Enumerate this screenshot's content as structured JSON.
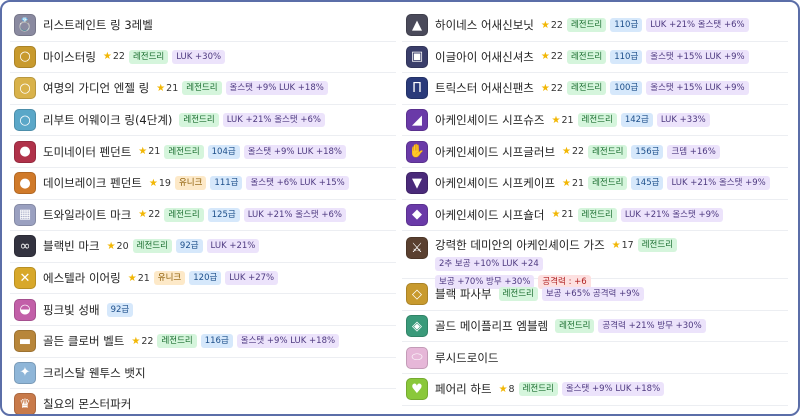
{
  "left": [
    {
      "icon": "ring-icon",
      "color": "#8a8aa0",
      "glyph": "💍",
      "name": "리스트레인트 링 3레벨",
      "star": "",
      "tier": "",
      "tier_class": "",
      "level": "",
      "stats": ""
    },
    {
      "icon": "ring-icon",
      "color": "#c89a2e",
      "glyph": "○",
      "name": "마이스터링",
      "star": "22",
      "tier": "레전드리",
      "tier_class": "t-leg",
      "level": "",
      "stats": "LUK +30%"
    },
    {
      "icon": "ring-icon",
      "color": "#d9b24a",
      "glyph": "○",
      "name": "여명의 가디언 엔젤 링",
      "star": "21",
      "tier": "레전드리",
      "tier_class": "t-leg",
      "level": "",
      "stats": "올스탯 +9% LUK +18%"
    },
    {
      "icon": "ring-icon",
      "color": "#5aa7c8",
      "glyph": "○",
      "name": "리부트 어웨이크 링(4단계)",
      "star": "",
      "tier": "레전드리",
      "tier_class": "t-leg",
      "level": "",
      "stats": "LUK +21% 올스탯 +6%"
    },
    {
      "icon": "pendant-icon",
      "color": "#b0324a",
      "glyph": "●",
      "name": "도미네이터 펜던트",
      "star": "21",
      "tier": "레전드리",
      "tier_class": "t-leg",
      "level": "104급",
      "stats": "올스탯 +9% LUK +18%"
    },
    {
      "icon": "pendant-icon",
      "color": "#d07a2a",
      "glyph": "●",
      "name": "데이브레이크 펜던트",
      "star": "19",
      "tier": "유니크",
      "tier_class": "t-uni",
      "level": "111급",
      "stats": "올스탯 +6% LUK +15%"
    },
    {
      "icon": "mark-icon",
      "color": "#9aa0c0",
      "glyph": "▦",
      "name": "트와일라이트 마크",
      "star": "22",
      "tier": "레전드리",
      "tier_class": "t-leg",
      "level": "125급",
      "stats": "LUK +21% 올스탯 +6%"
    },
    {
      "icon": "glasses-icon",
      "color": "#333340",
      "glyph": "∞",
      "name": "블랙빈 마크",
      "star": "20",
      "tier": "레전드리",
      "tier_class": "t-leg",
      "level": "92급",
      "stats": "LUK +21%"
    },
    {
      "icon": "earring-icon",
      "color": "#d8a82a",
      "glyph": "✕",
      "name": "에스텔라 이어링",
      "star": "21",
      "tier": "유니크",
      "tier_class": "t-uni",
      "level": "120급",
      "stats": "LUK +27%"
    },
    {
      "icon": "pocket-icon",
      "color": "#c25fa8",
      "glyph": "◒",
      "name": "핑크빛 성배",
      "star": "",
      "tier": "",
      "tier_class": "",
      "level": "92급",
      "stats": ""
    },
    {
      "icon": "belt-icon",
      "color": "#b8863a",
      "glyph": "▬",
      "name": "골든 클로버 벨트",
      "star": "22",
      "tier": "레전드리",
      "tier_class": "t-leg",
      "level": "116급",
      "stats": "올스탯 +9% LUK +18%"
    },
    {
      "icon": "badge-icon",
      "color": "#8fb6d8",
      "glyph": "✦",
      "name": "크리스탈 웬투스 뱃지",
      "star": "",
      "tier": "",
      "tier_class": "",
      "level": "",
      "stats": ""
    },
    {
      "icon": "medal-icon",
      "color": "#c87a4a",
      "glyph": "♛",
      "name": "칠요의 몬스터파커",
      "star": "",
      "tier": "",
      "tier_class": "",
      "level": "",
      "stats": ""
    }
  ],
  "right": [
    {
      "icon": "hat-icon",
      "color": "#4a4a5a",
      "glyph": "▲",
      "name": "하이네스 어새신보닛",
      "star": "22",
      "tier": "레전드리",
      "tier_class": "t-leg",
      "level": "110급",
      "stats": "LUK +21% 올스탯 +6%"
    },
    {
      "icon": "top-icon",
      "color": "#3a3e6a",
      "glyph": "▣",
      "name": "이글아이 어새신셔츠",
      "star": "22",
      "tier": "레전드리",
      "tier_class": "t-leg",
      "level": "110급",
      "stats": "올스탯 +15% LUK +9%"
    },
    {
      "icon": "pants-icon",
      "color": "#2a3a7a",
      "glyph": "Π",
      "name": "트릭스터 어새신팬츠",
      "star": "22",
      "tier": "레전드리",
      "tier_class": "t-leg",
      "level": "100급",
      "stats": "올스탯 +15% LUK +9%"
    },
    {
      "icon": "shoes-icon",
      "color": "#6a3aa8",
      "glyph": "◢",
      "name": "아케인셰이드 시프슈즈",
      "star": "21",
      "tier": "레전드리",
      "tier_class": "t-leg",
      "level": "142급",
      "stats": "LUK +33%"
    },
    {
      "icon": "gloves-icon",
      "color": "#6a3aa8",
      "glyph": "✋",
      "name": "아케인셰이드 시프글러브",
      "star": "22",
      "tier": "레전드리",
      "tier_class": "t-leg",
      "level": "156급",
      "stats": "크뎀 +16%"
    },
    {
      "icon": "cape-icon",
      "color": "#4a2a7a",
      "glyph": "▼",
      "name": "아케인셰이드 시프케이프",
      "star": "21",
      "tier": "레전드리",
      "tier_class": "t-leg",
      "level": "145급",
      "stats": "LUK +21% 올스탯 +9%"
    },
    {
      "icon": "shoulder-icon",
      "color": "#6a3aa8",
      "glyph": "◆",
      "name": "아케인셰이드 시프숄더",
      "star": "21",
      "tier": "레전드리",
      "tier_class": "t-leg",
      "level": "",
      "stats": "LUK +21% 올스탯 +9%"
    },
    {
      "icon": "weapon-icon",
      "color": "#5a4030",
      "glyph": "⚔",
      "name": "강력한 데미안의 아케인셰이드 가즈",
      "star": "17",
      "tier": "레전드리",
      "tier_class": "t-leg",
      "level": "",
      "stats": "2추 보공 +10% LUK +24",
      "extra_stats": [
        "보공 +70% 방무 +30%"
      ],
      "extra_red": "공격력 : +6"
    },
    {
      "icon": "subweapon-icon",
      "color": "#c89a2e",
      "glyph": "◇",
      "name": "블랙 파사부",
      "star": "",
      "tier": "레전드리",
      "tier_class": "t-leg",
      "level": "",
      "stats": "보공 +65% 공격력 +9%"
    },
    {
      "icon": "emblem-icon",
      "color": "#3a9a7a",
      "glyph": "◈",
      "name": "골드 메이플리프 엠블렘",
      "star": "",
      "tier": "레전드리",
      "tier_class": "t-leg",
      "level": "",
      "stats": "공격력 +21% 방무 +30%"
    },
    {
      "icon": "heart-icon",
      "color": "#e6b7d8",
      "glyph": "⬭",
      "name": "루시드로이드",
      "star": "",
      "tier": "",
      "tier_class": "",
      "level": "",
      "stats": ""
    },
    {
      "icon": "heart-icon",
      "color": "#8ac83a",
      "glyph": "♥",
      "name": "페어리 하트",
      "star": "8",
      "tier": "레전드리",
      "tier_class": "t-leg",
      "level": "",
      "stats": "올스탯 +9% LUK +18%"
    }
  ]
}
